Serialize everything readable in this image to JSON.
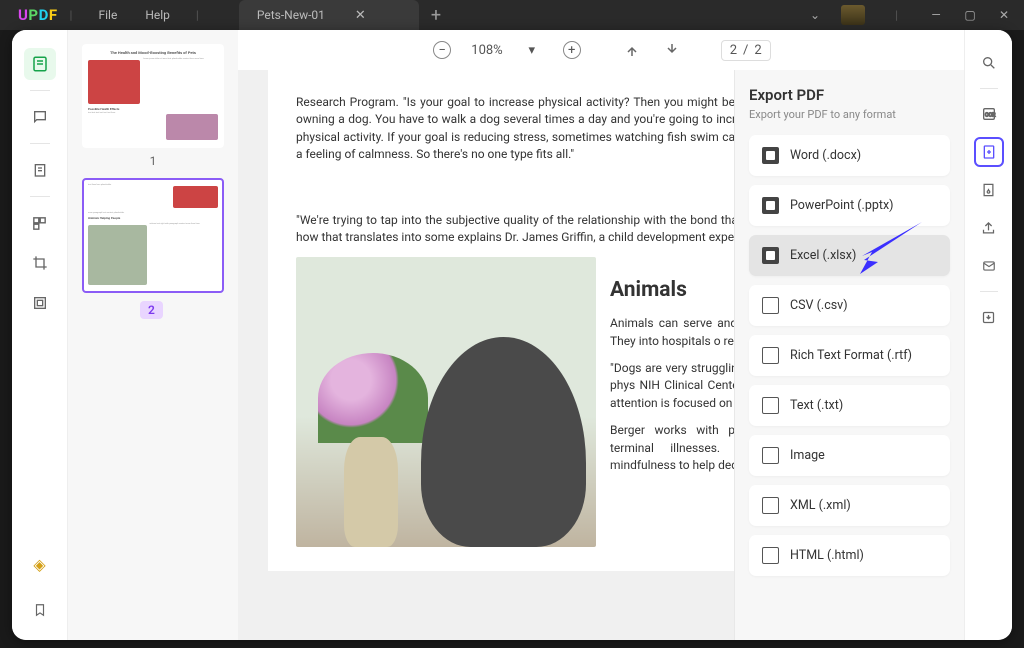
{
  "app": {
    "name_u": "U",
    "name_p": "P",
    "name_d": "D",
    "name_f": "F"
  },
  "menu": {
    "file": "File",
    "help": "Help"
  },
  "tab": {
    "title": "Pets-New-01"
  },
  "toolbar": {
    "zoom": "108%",
    "page_cur": "2",
    "page_sep": "/",
    "page_total": "2"
  },
  "thumb1": {
    "num": "1",
    "title": "The Health and Mood-Boosting Benefits of Pets",
    "sec": "Possible Health Effects"
  },
  "thumb2": {
    "num": "2",
    "sec": "Animals Helping People"
  },
  "export": {
    "title": "Export PDF",
    "sub": "Export your PDF to any format",
    "opts": [
      {
        "label": "Word (.docx)"
      },
      {
        "label": "PowerPoint (.pptx)"
      },
      {
        "label": "Excel (.xlsx)"
      },
      {
        "label": "CSV (.csv)"
      },
      {
        "label": "Rich Text Format (.rtf)"
      },
      {
        "label": "Text (.txt)"
      },
      {
        "label": "Image"
      },
      {
        "label": "XML (.xml)"
      },
      {
        "label": "HTML (.html)"
      }
    ]
  },
  "doc": {
    "p1": "Research Program. \"Is your goal to increase physical activity? Then you might benefit from owning a dog. You have to walk a dog several times a day and you're going to increase your physical activity.  If your goal is reducing stress, sometimes watching fish swim can result in a feeling of calmness. So there's no one type fits all.\"",
    "p2": "\"We're trying to tap into the subjective quality of the relationship with the bond that people feel with animals—and how that translates into some explains Dr. James Griffin, a child development expert at NIH.",
    "h2": "Animals",
    "p3": "Animals can serve and support. They're good at this. They into hospitals o reduce patients",
    "p4": "\"Dogs are very struggling with to sit there and Berger, a phys NIH Clinical Center in Bethesda, Maryland. \"Their attention is focused on the person all the time.\"",
    "p5": "Berger works with people who have cancer and terminal illnesses. She teaches them about mindfulness to help decrease stress and manage"
  }
}
